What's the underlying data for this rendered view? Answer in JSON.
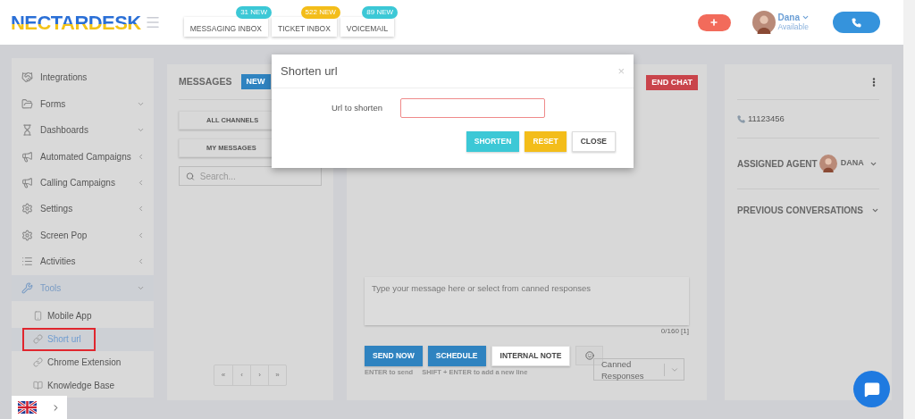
{
  "header": {
    "logo": "NECTARDESK",
    "inboxes": [
      {
        "label": "MESSAGING INBOX",
        "badge": "31 NEW",
        "color": "#3cc8d6"
      },
      {
        "label": "TICKET INBOX",
        "badge": "522 NEW",
        "color": "#f3bd1a"
      },
      {
        "label": "VOICEMAIL",
        "badge": "89 NEW",
        "color": "#3cc8d6"
      }
    ],
    "user": {
      "name": "Dana",
      "status": "Available"
    }
  },
  "sidebar": {
    "items": [
      {
        "label": "Integrations",
        "kind": "link",
        "selected": false
      },
      {
        "label": "Forms",
        "kind": "dropdown",
        "selected": false
      },
      {
        "label": "Dashboards",
        "kind": "dropdown",
        "selected": false
      },
      {
        "label": "Automated Campaigns",
        "kind": "submenu",
        "selected": false
      },
      {
        "label": "Calling Campaigns",
        "kind": "submenu",
        "selected": false
      },
      {
        "label": "Settings",
        "kind": "submenu",
        "selected": false
      },
      {
        "label": "Screen Pop",
        "kind": "submenu",
        "selected": false
      },
      {
        "label": "Activities",
        "kind": "submenu",
        "selected": false
      },
      {
        "label": "Tools",
        "kind": "dropdown",
        "selected": true,
        "children": [
          {
            "label": "Mobile App",
            "selected": false,
            "highlighted": false
          },
          {
            "label": "Short url",
            "selected": true,
            "highlighted": true
          },
          {
            "label": "Chrome Extension",
            "selected": false,
            "highlighted": false
          },
          {
            "label": "Knowledge Base",
            "selected": false,
            "highlighted": false
          }
        ]
      }
    ]
  },
  "messages": {
    "title": "MESSAGES",
    "new_button": "NEW",
    "filters": [
      "ALL CHANNELS",
      "MY MESSAGES"
    ],
    "search": {
      "placeholder": "Search..."
    },
    "pager": [
      "«",
      "‹",
      "›",
      "»"
    ]
  },
  "chat": {
    "end_chat": "END CHAT",
    "composer": {
      "placeholder": "Type your message here or select from canned responses"
    },
    "counter": "0/160 [1]",
    "buttons": [
      {
        "label": "SEND NOW",
        "kind": "primary"
      },
      {
        "label": "SCHEDULE",
        "kind": "primary"
      },
      {
        "label": "INTERNAL NOTE",
        "kind": "default"
      }
    ],
    "canned": "Canned Responses",
    "hints": [
      "ENTER to send",
      "SHIFT + ENTER to add a new line"
    ]
  },
  "contact": {
    "phone": "11123456",
    "assigned_label": "ASSIGNED AGENT",
    "agent": "DANA",
    "previous": "PREVIOUS CONVERSATIONS"
  },
  "dialog": {
    "title": "Shorten url",
    "close": "×",
    "field_label": "Url to shorten",
    "buttons": [
      {
        "label": "SHORTEN",
        "kind": "info"
      },
      {
        "label": "RESET",
        "kind": "warning"
      },
      {
        "label": "CLOSE",
        "kind": "default"
      }
    ]
  }
}
